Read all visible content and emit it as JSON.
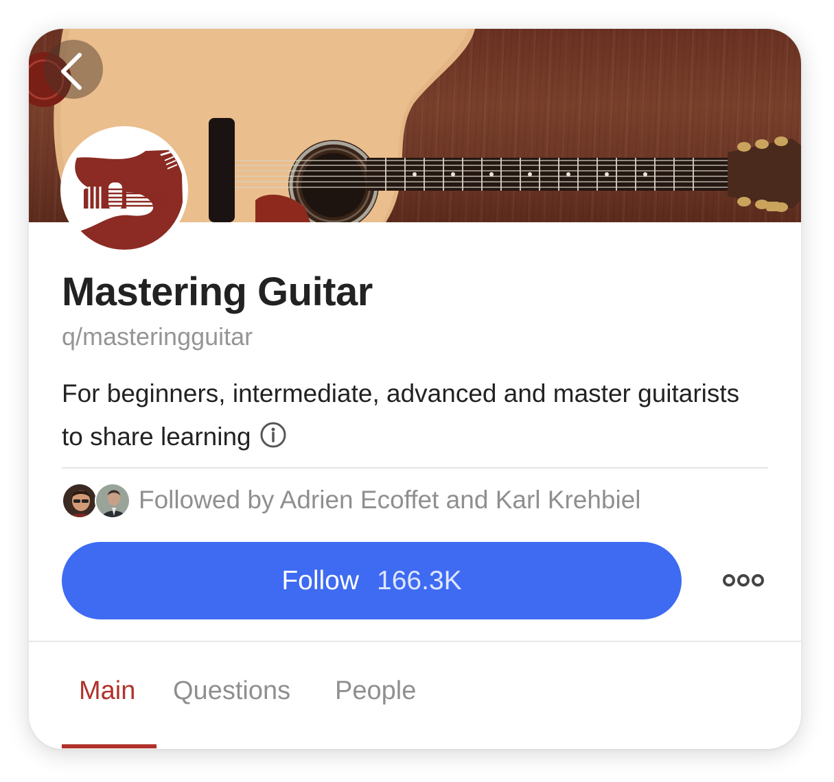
{
  "community": {
    "name": "Mastering Guitar",
    "handle": "q/masteringguitar",
    "description": "For beginners, intermediate, advanced and master guitarists to share learning"
  },
  "followers": {
    "text": "Followed by Adrien Ecoffet and Karl Krehbiel",
    "avatars": [
      "Adrien Ecoffet",
      "Karl Krehbiel"
    ]
  },
  "follow_button": {
    "label": "Follow",
    "count": "166.3K"
  },
  "tabs": [
    {
      "label": "Main",
      "active": true
    },
    {
      "label": "Questions",
      "active": false
    },
    {
      "label": "People",
      "active": false
    }
  ],
  "icons": {
    "back": "chevron-left-icon",
    "info": "info-icon",
    "more": "more-icon"
  },
  "colors": {
    "accent_blue": "#3e6bf2",
    "active_tab": "#b0322a",
    "logo_red": "#8b2b23",
    "banner_wood": "#6f3a26"
  }
}
